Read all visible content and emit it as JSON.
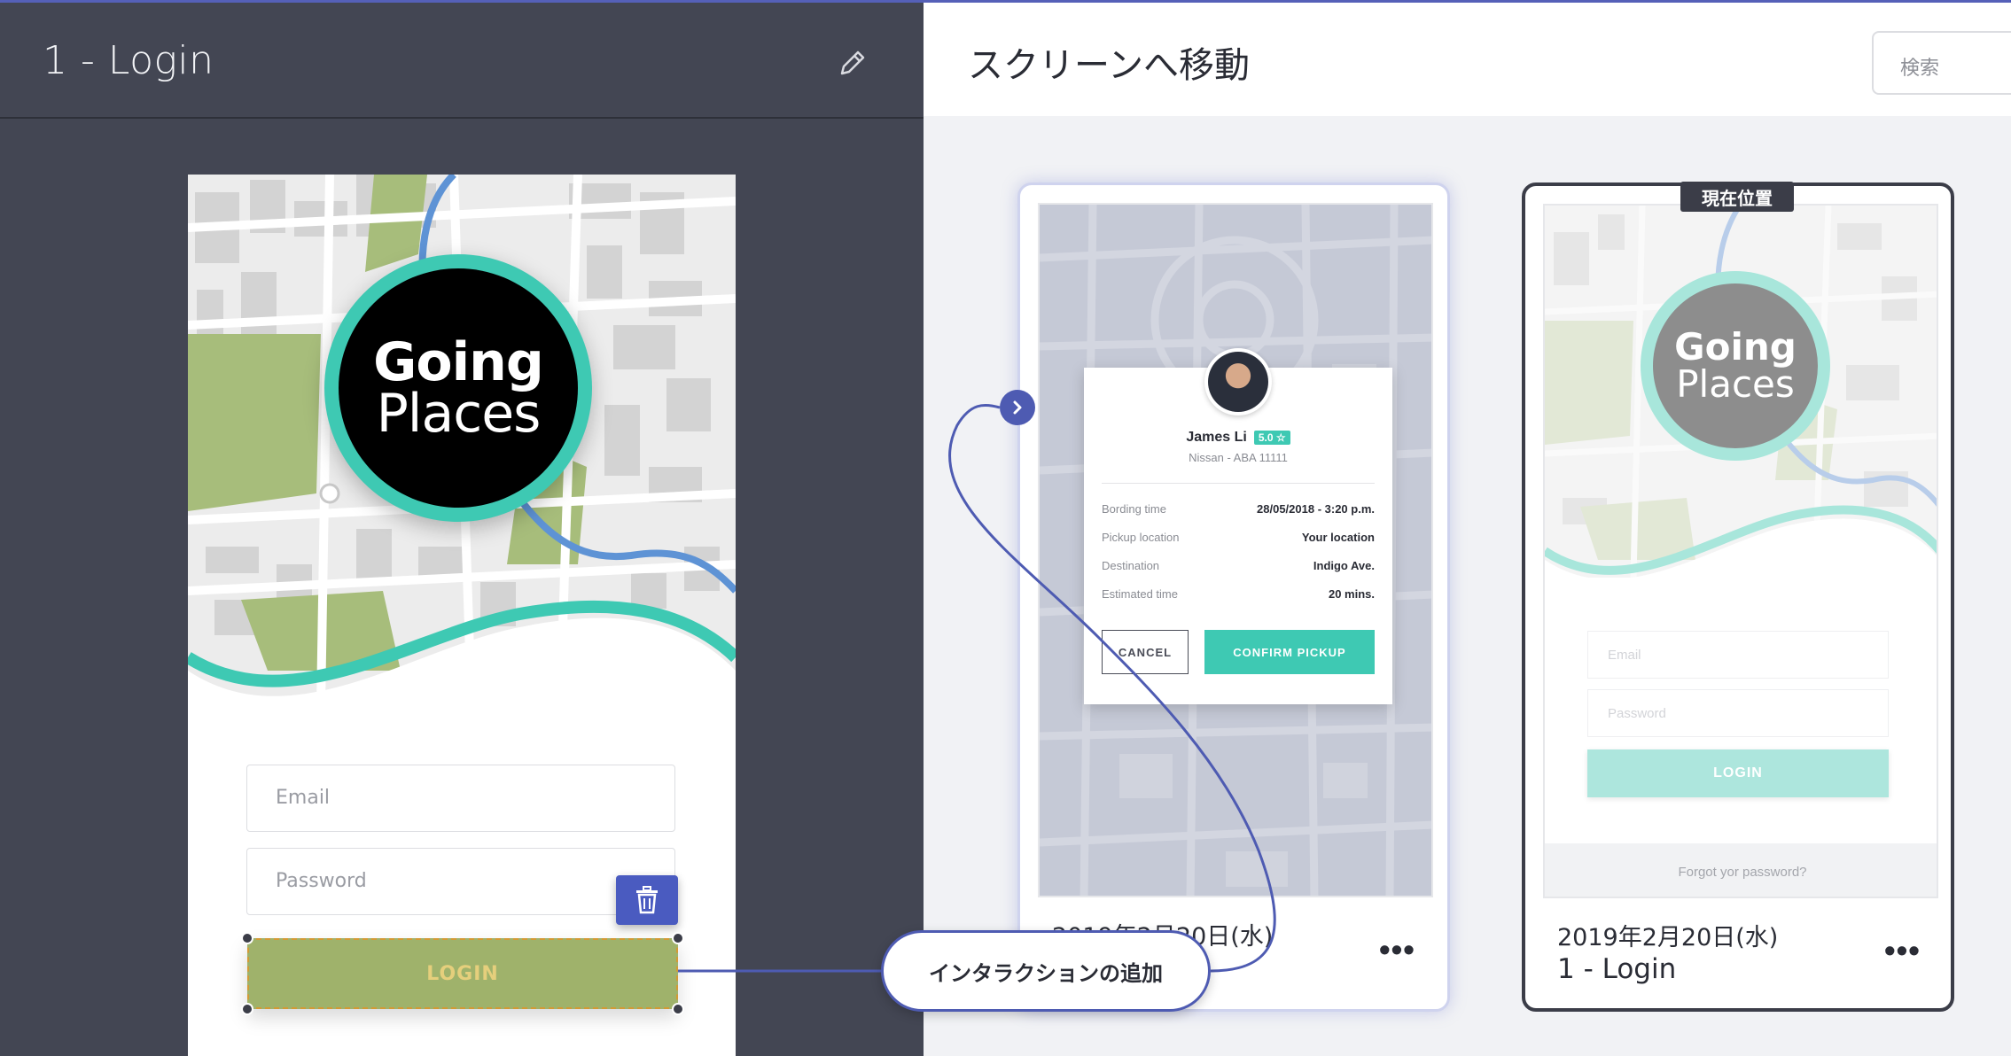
{
  "editor": {
    "screen_title": "1 - Login",
    "edit_icon": "pencil-icon"
  },
  "app_preview": {
    "logo_line1": "Going",
    "logo_line2": "Places",
    "email_placeholder": "Email",
    "password_placeholder": "Password",
    "login_label": "LOGIN",
    "delete_icon": "trash-icon"
  },
  "interaction": {
    "add_label": "インタラクションの追加"
  },
  "navigator": {
    "title": "スクリーンへ移動",
    "search_placeholder": "検索",
    "current_badge": "現在位置",
    "cards": [
      {
        "date": "2019年2月20日(水)",
        "name": "",
        "more": "•••",
        "dialog": {
          "driver_name": "James Li",
          "rating": "5.0 ☆",
          "vehicle": "Nissan - ABA 11111",
          "rows": [
            {
              "label": "Bording time",
              "value": "28/05/2018 - 3:20 p.m."
            },
            {
              "label": "Pickup location",
              "value": "Your location"
            },
            {
              "label": "Destination",
              "value": "Indigo Ave."
            },
            {
              "label": "Estimated time",
              "value": "20 mins."
            }
          ],
          "cancel": "CANCEL",
          "confirm": "CONFIRM PICKUP"
        }
      },
      {
        "date": "2019年2月20日(水)",
        "name": "1 - Login",
        "more": "•••",
        "thumb": {
          "logo_line1": "Going",
          "logo_line2": "Places",
          "email": "Email",
          "password": "Password",
          "login": "LOGIN",
          "forgot": "Forgot yor password?"
        }
      }
    ]
  },
  "colors": {
    "accent_teal": "#3ec9b3",
    "accent_indigo": "#4e5bb2",
    "editor_bg": "#434653",
    "selected_button": "#9fb26b"
  }
}
